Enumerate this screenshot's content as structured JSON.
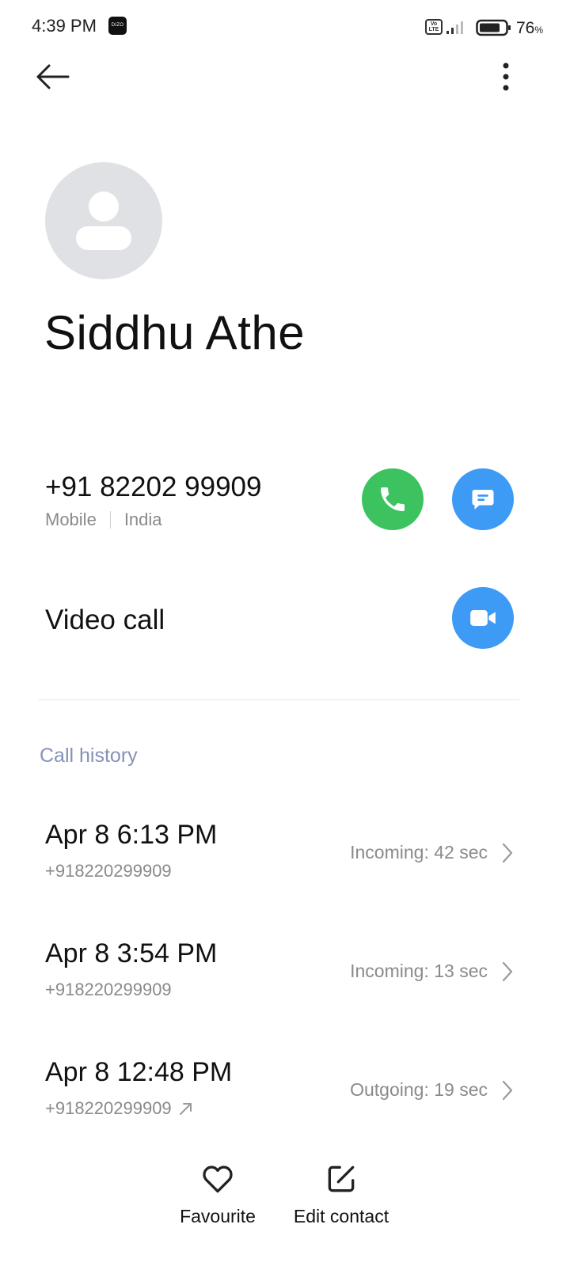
{
  "status_bar": {
    "time": "4:39 PM",
    "dizo_badge": "DIZO",
    "volte": "Vo\nLTE",
    "battery_percent": "76",
    "battery_unit": "%",
    "battery_level": 0.76
  },
  "contact": {
    "name": "Siddhu Athe",
    "phone": "+91 82202 99909",
    "phone_type": "Mobile",
    "phone_region": "India"
  },
  "video_call_label": "Video call",
  "call_history": {
    "title": "Call history",
    "items": [
      {
        "date": "Apr 8 6:13 PM",
        "number": "+918220299909",
        "status": "Incoming: 42 sec",
        "outgoing": false
      },
      {
        "date": "Apr 8 3:54 PM",
        "number": "+918220299909",
        "status": "Incoming: 13 sec",
        "outgoing": false
      },
      {
        "date": "Apr 8 12:48 PM",
        "number": "+918220299909",
        "status": "Outgoing: 19 sec",
        "outgoing": true
      }
    ]
  },
  "bottom_actions": {
    "favourite": "Favourite",
    "edit_contact": "Edit contact"
  },
  "colors": {
    "call_green": "#3cc35f",
    "action_blue": "#3d9af5",
    "section_title": "#8591b8",
    "avatar_bg": "#dfe1e5"
  }
}
